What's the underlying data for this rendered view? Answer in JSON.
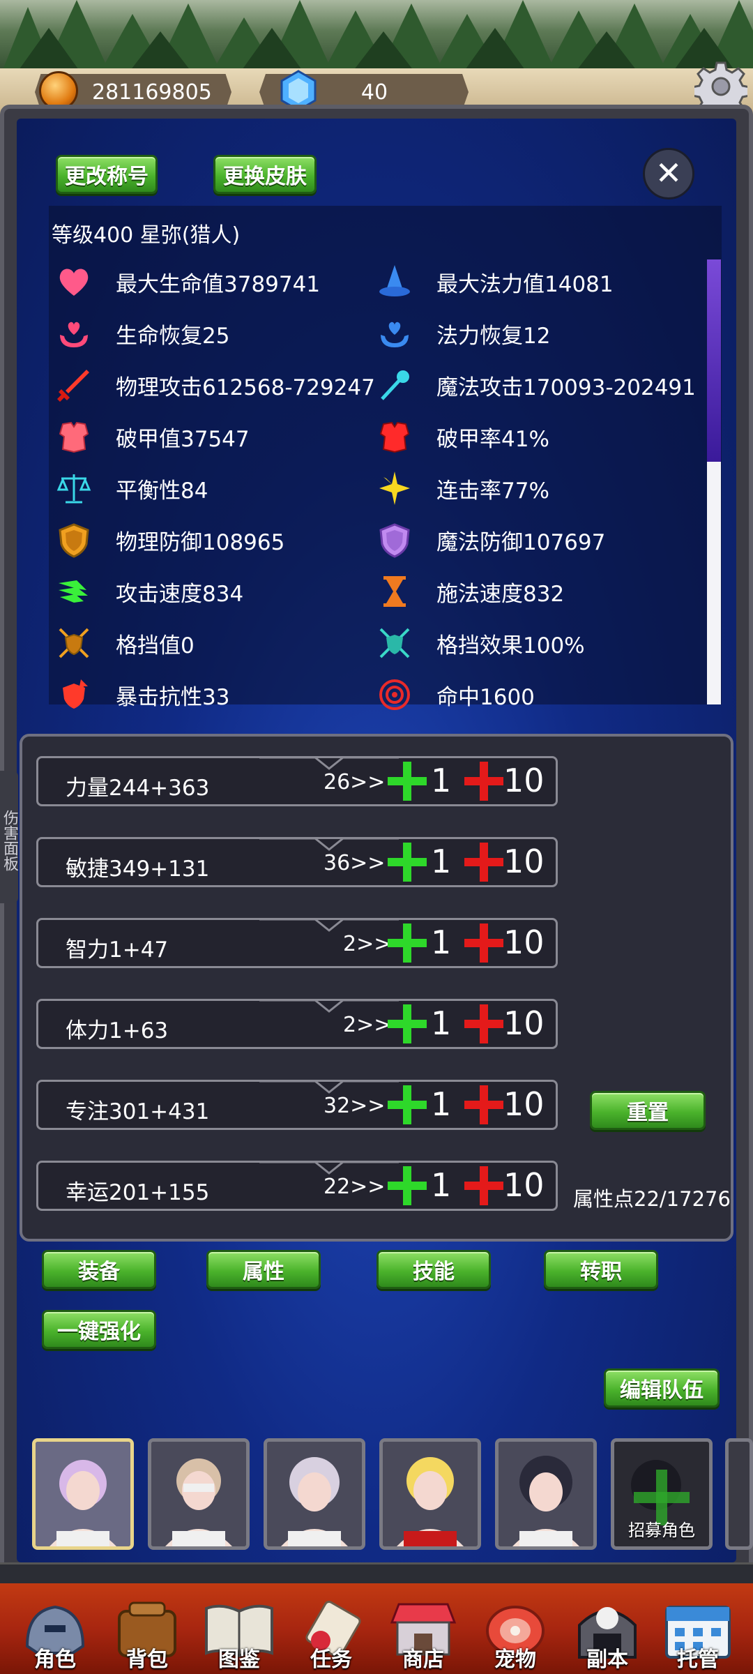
{
  "currency": {
    "gold": "281169805",
    "gems": "40"
  },
  "header": {
    "change_title_label": "更改称号",
    "change_skin_label": "更换皮肤",
    "close_label": "✕",
    "character_line": "等级400   星弥(猎人)"
  },
  "stats": {
    "left": [
      {
        "label": "最大生命值3789741",
        "icon": "heart-icon"
      },
      {
        "label": "生命恢复25",
        "icon": "hp-regen-icon"
      },
      {
        "label": "物理攻击612568-729247",
        "icon": "sword-icon"
      },
      {
        "label": "破甲值37547",
        "icon": "armor-break-icon"
      },
      {
        "label": "平衡性84",
        "icon": "scales-icon"
      },
      {
        "label": "物理防御108965",
        "icon": "shield-icon"
      },
      {
        "label": "攻击速度834",
        "icon": "attack-speed-icon"
      },
      {
        "label": "格挡值0",
        "icon": "crossed-swords-shield-icon"
      },
      {
        "label": "暴击抗性33",
        "icon": "crit-resist-icon"
      }
    ],
    "right": [
      {
        "label": "最大法力值14081",
        "icon": "wizard-hat-icon"
      },
      {
        "label": "法力恢复12",
        "icon": "mp-regen-icon"
      },
      {
        "label": "魔法攻击170093-202491",
        "icon": "wand-icon"
      },
      {
        "label": "破甲率41%",
        "icon": "armor-break-rate-icon"
      },
      {
        "label": "连击率77%",
        "icon": "star-burst-icon"
      },
      {
        "label": "魔法防御107697",
        "icon": "magic-shield-icon"
      },
      {
        "label": "施法速度832",
        "icon": "hourglass-icon"
      },
      {
        "label": "格挡效果100%",
        "icon": "block-effect-icon"
      },
      {
        "label": "命中1600",
        "icon": "target-icon"
      }
    ]
  },
  "attributes": [
    {
      "label": "力量244+363",
      "cost": "26>>"
    },
    {
      "label": "敏捷349+131",
      "cost": "36>>"
    },
    {
      "label": "智力1+47",
      "cost": "2>>"
    },
    {
      "label": "体力1+63",
      "cost": "2>>"
    },
    {
      "label": "专注301+431",
      "cost": "32>>"
    },
    {
      "label": "幸运201+155",
      "cost": "22>>"
    }
  ],
  "attr_controls": {
    "plus_one": "1",
    "plus_ten": "10",
    "reset_label": "重置",
    "points": "属性点22/17276"
  },
  "side_tab": "伤害面板",
  "actions": {
    "equip": "装备",
    "attributes": "属性",
    "skills": "技能",
    "job_change": "转职",
    "one_click_enhance": "一键强化",
    "edit_team": "编辑队伍"
  },
  "roster": {
    "recruit_label": "招募角色"
  },
  "nav": {
    "character": "角色",
    "bag": "背包",
    "codex": "图鉴",
    "quest": "任务",
    "shop": "商店",
    "pet": "宠物",
    "dungeon": "副本",
    "hosting": "托管"
  },
  "colors": {
    "panel_blue": "#102a85",
    "button_green": "#4bb32c",
    "plus_green": "#2ed82a",
    "plus_red": "#e41a1a",
    "nav_red": "#a82610"
  }
}
